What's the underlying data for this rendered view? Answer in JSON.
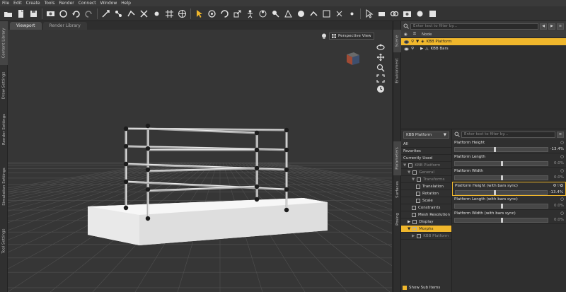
{
  "menu": [
    "File",
    "Edit",
    "Create",
    "Tools",
    "Render",
    "Connect",
    "Window",
    "Help"
  ],
  "toolbar_icons": [
    "open-folder-icon",
    "new-file-icon",
    "save-icon",
    "render-icon",
    "toggle-icon",
    "undo-icon",
    "redo-icon",
    "transform-icon",
    "node-icon",
    "joint-icon",
    "tool-icon",
    "tool-icon",
    "grid-icon",
    "move-icon",
    "select-arrow-icon",
    "rotate-icon",
    "spin-icon",
    "scale-icon",
    "pose-icon",
    "region-icon",
    "joint-editor-icon",
    "tool-icon",
    "tool-icon",
    "tool-icon",
    "tool-icon",
    "tool-icon",
    "tool-icon",
    "select-icon",
    "tool-icon",
    "render-settings-icon",
    "camera-icon",
    "tool-icon",
    "tool-icon"
  ],
  "left_tabs": [
    "Content Library",
    "Draw Settings",
    "Render Settings",
    "Simulation Settings",
    "Tool Settings"
  ],
  "viewport": {
    "tabs": [
      "Viewport",
      "Render Library"
    ],
    "camera": "Perspective View"
  },
  "right_tabs": [
    "Scene",
    "Environment",
    "Parameters",
    "Surfaces",
    "Posing"
  ],
  "scene": {
    "filter_placeholder": "Enter text to filter by...",
    "header": "Node",
    "nodes": [
      {
        "label": "KBB Platform",
        "selected": true
      },
      {
        "label": "KBB Bars",
        "selected": false
      }
    ]
  },
  "parameters": {
    "node_select": "KBB Platform",
    "filter_placeholder": "Enter text to filter by...",
    "categories": [
      {
        "label": "All",
        "state": "normal",
        "indent": 0
      },
      {
        "label": "Favorites",
        "state": "normal",
        "indent": 0
      },
      {
        "label": "Currently Used",
        "state": "normal",
        "indent": 0
      },
      {
        "label": "KBB Platform",
        "state": "dim",
        "indent": 0
      },
      {
        "label": "General",
        "state": "dim",
        "indent": 1
      },
      {
        "label": "Transforms",
        "state": "dim",
        "indent": 2
      },
      {
        "label": "Translation",
        "state": "normal",
        "indent": 3
      },
      {
        "label": "Rotation",
        "state": "normal",
        "indent": 3
      },
      {
        "label": "Scale",
        "state": "normal",
        "indent": 3
      },
      {
        "label": "Constraints",
        "state": "normal",
        "indent": 2
      },
      {
        "label": "Mesh Resolution",
        "state": "normal",
        "indent": 2
      },
      {
        "label": "Display",
        "state": "normal",
        "indent": 1
      },
      {
        "label": "Morphs",
        "state": "selected",
        "indent": 1
      },
      {
        "label": "KBB Platform",
        "state": "dim",
        "indent": 2
      }
    ],
    "show_sub_items": "Show Sub Items",
    "params": [
      {
        "name": "Platform Height",
        "value": "-13.4%",
        "fraction": 0.43,
        "selected": false
      },
      {
        "name": "Platform Length",
        "value": "0.0%",
        "fraction": 0.5,
        "selected": false
      },
      {
        "name": "Platform Width",
        "value": "0.0%",
        "fraction": 0.5,
        "selected": false
      },
      {
        "name": "Platform Height (with bars sync)",
        "value": "-13.4%",
        "fraction": 0.43,
        "selected": true
      },
      {
        "name": "Platform Length (with bars sync)",
        "value": "0.0%",
        "fraction": 0.5,
        "selected": false
      },
      {
        "name": "Platform Width (with bars sync)",
        "value": "0.0%",
        "fraction": 0.5,
        "selected": false
      }
    ]
  },
  "colors": {
    "accent": "#f0b72c",
    "panel": "#2f2f2f",
    "viewport": "#353535"
  }
}
